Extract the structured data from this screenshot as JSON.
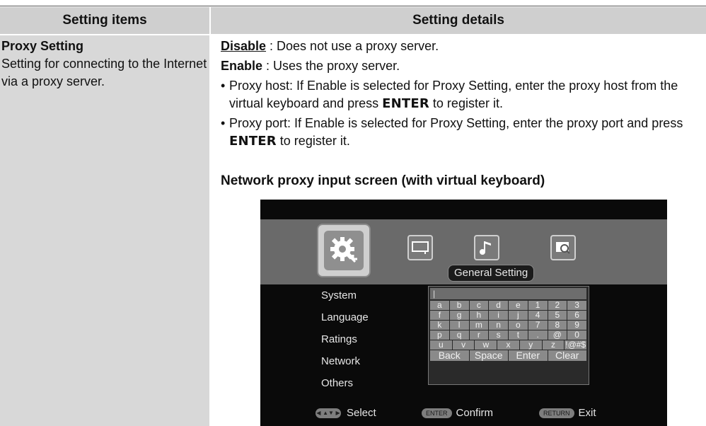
{
  "table": {
    "header_left": "Setting items",
    "header_right": "Setting details",
    "left_title": "Proxy Setting",
    "left_desc": "Setting for connecting to the Internet via a proxy server.",
    "opt_disable_label": "Disable",
    "opt_disable_text": " : Does not use a proxy server.",
    "opt_enable_label": "Enable",
    "opt_enable_text": " : Uses the proxy server.",
    "bullet1_a": "Proxy host: If Enable is selected for Proxy Setting, enter the proxy host from the virtual keyboard and press ",
    "bullet1_key": "ENTER",
    "bullet1_b": " to register it.",
    "bullet2_a": "Proxy port: If Enable is selected for Proxy Setting, enter the proxy port and press ",
    "bullet2_key": "ENTER",
    "bullet2_b": " to register it.",
    "caption": "Network proxy input screen (with virtual keyboard)"
  },
  "screen": {
    "active_label": "General Setting",
    "menu": [
      "System",
      "Language",
      "Ratings",
      "Network",
      "Others"
    ],
    "input_value": "|",
    "keyboard_rows": [
      [
        "a",
        "b",
        "c",
        "d",
        "e",
        "1",
        "2",
        "3"
      ],
      [
        "f",
        "g",
        "h",
        "i",
        "j",
        "4",
        "5",
        "6"
      ],
      [
        "k",
        "l",
        "m",
        "n",
        "o",
        "7",
        "8",
        "9"
      ],
      [
        "p",
        "q",
        "r",
        "s",
        "t",
        ".",
        "@",
        "0"
      ],
      [
        "u",
        "v",
        "w",
        "x",
        "y",
        "z",
        "!@#$"
      ]
    ],
    "keyboard_bottom": [
      "Back",
      "Space",
      "Enter",
      "Clear"
    ],
    "footer": {
      "select_label": "Select",
      "enter_pill": "ENTER",
      "confirm_label": "Confirm",
      "return_pill": "RETURN",
      "exit_label": "Exit"
    },
    "icons": [
      "general-setting-icon",
      "display-icon",
      "audio-icon",
      "search-book-icon"
    ]
  }
}
